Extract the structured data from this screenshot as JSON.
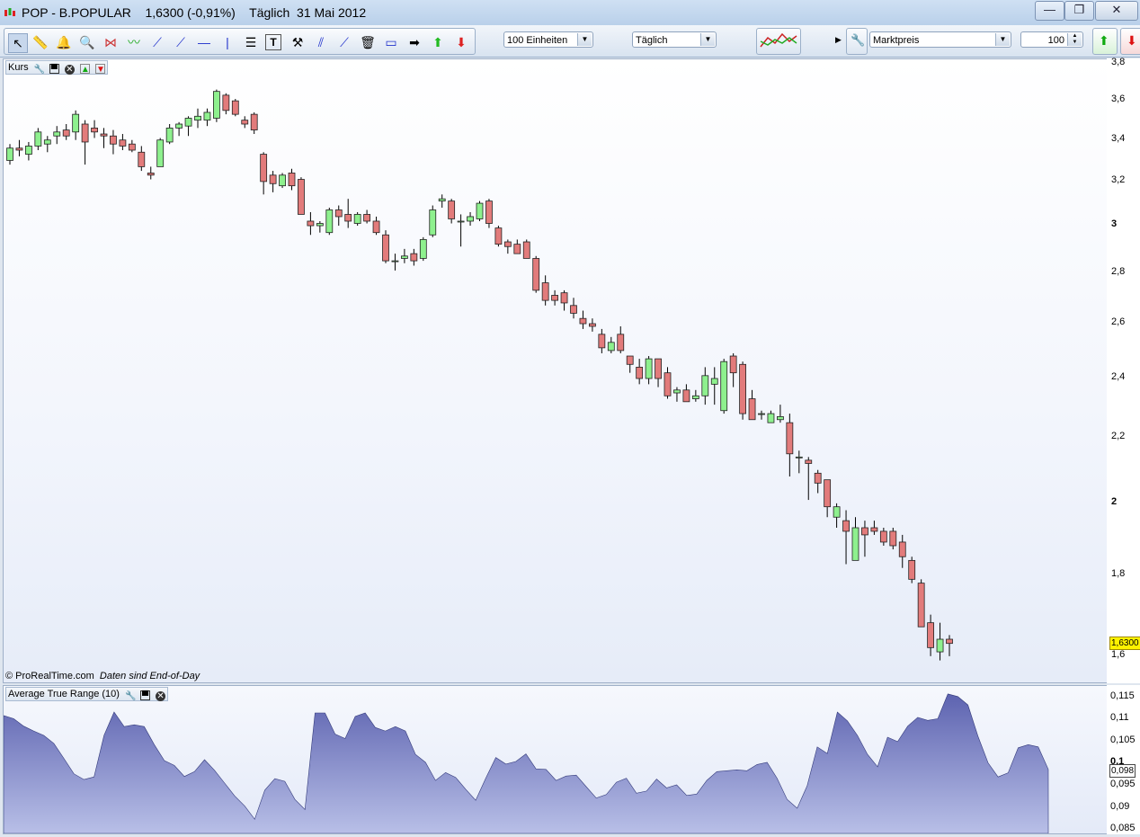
{
  "window": {
    "title": "POP - B.POPULAR    1,6300 (-0,91%)    Täglich  31 Mai 2012",
    "minimize_label": "—",
    "restore_label": "❐",
    "close_label": "✕"
  },
  "toolbar": {
    "units_select": "100 Einheiten",
    "period_select": "Täglich",
    "price_type_select": "Marktpreis",
    "quantity_value": "100"
  },
  "price_pane": {
    "header_label": "Kurs",
    "copyright": "© ProRealTime.com",
    "data_note": "Daten sind End-of-Day",
    "current_price_label": "1,6300",
    "y_ticks": [
      "3,8",
      "3,6",
      "3,4",
      "3,2",
      "3",
      "2,8",
      "2,6",
      "2,4",
      "2,2",
      "2",
      "1,8",
      "1,6"
    ]
  },
  "atr_pane": {
    "header_label": "Average True Range (10)",
    "current_value_label": "0,098",
    "y_ticks": [
      "0,115",
      "0,11",
      "0,105",
      "0,1",
      "0,095",
      "0,09",
      "0,085"
    ]
  },
  "colors": {
    "up_candle": "#8ef08e",
    "down_candle": "#e27b7b",
    "atr_fill_top": "#5d63b0",
    "atr_fill_bottom": "#b8bfe7",
    "price_label_bg": "#fff200"
  },
  "chart_data": [
    {
      "type": "candlestick",
      "title": "Kurs",
      "y_scale": "log",
      "ylim": [
        1.55,
        3.8
      ],
      "y_ticks": [
        3.8,
        3.6,
        3.4,
        3.2,
        3.0,
        2.8,
        2.6,
        2.4,
        2.2,
        2.0,
        1.8,
        1.6
      ],
      "last_value": 1.63,
      "candles": [
        [
          3.3,
          3.38,
          3.28,
          3.36
        ],
        [
          3.36,
          3.4,
          3.32,
          3.35
        ],
        [
          3.33,
          3.39,
          3.3,
          3.37
        ],
        [
          3.37,
          3.46,
          3.35,
          3.44
        ],
        [
          3.38,
          3.42,
          3.34,
          3.4
        ],
        [
          3.42,
          3.47,
          3.38,
          3.44
        ],
        [
          3.45,
          3.48,
          3.4,
          3.42
        ],
        [
          3.44,
          3.55,
          3.4,
          3.53
        ],
        [
          3.48,
          3.5,
          3.28,
          3.39
        ],
        [
          3.46,
          3.5,
          3.41,
          3.44
        ],
        [
          3.43,
          3.46,
          3.36,
          3.42
        ],
        [
          3.42,
          3.45,
          3.33,
          3.38
        ],
        [
          3.4,
          3.43,
          3.35,
          3.37
        ],
        [
          3.38,
          3.4,
          3.34,
          3.35
        ],
        [
          3.34,
          3.37,
          3.25,
          3.27
        ],
        [
          3.24,
          3.27,
          3.21,
          3.23
        ],
        [
          3.27,
          3.41,
          3.27,
          3.4
        ],
        [
          3.39,
          3.48,
          3.38,
          3.46
        ],
        [
          3.46,
          3.49,
          3.42,
          3.48
        ],
        [
          3.47,
          3.52,
          3.42,
          3.51
        ],
        [
          3.5,
          3.56,
          3.46,
          3.52
        ],
        [
          3.5,
          3.56,
          3.47,
          3.54
        ],
        [
          3.51,
          3.66,
          3.49,
          3.65
        ],
        [
          3.63,
          3.64,
          3.53,
          3.55
        ],
        [
          3.6,
          3.61,
          3.52,
          3.53
        ],
        [
          3.5,
          3.52,
          3.46,
          3.48
        ],
        [
          3.53,
          3.54,
          3.43,
          3.45
        ],
        [
          3.33,
          3.34,
          3.14,
          3.2
        ],
        [
          3.23,
          3.25,
          3.15,
          3.19
        ],
        [
          3.18,
          3.24,
          3.17,
          3.23
        ],
        [
          3.24,
          3.26,
          3.16,
          3.18
        ],
        [
          3.21,
          3.22,
          3.06,
          3.05
        ],
        [
          3.02,
          3.06,
          2.96,
          3.0
        ],
        [
          3.0,
          3.02,
          2.97,
          3.01
        ],
        [
          2.97,
          3.08,
          2.96,
          3.07
        ],
        [
          3.07,
          3.09,
          3.0,
          3.04
        ],
        [
          3.05,
          3.12,
          2.99,
          3.02
        ],
        [
          3.01,
          3.06,
          3.0,
          3.05
        ],
        [
          3.05,
          3.07,
          3.01,
          3.02
        ],
        [
          3.02,
          3.04,
          2.96,
          2.97
        ],
        [
          2.96,
          2.98,
          2.84,
          2.85
        ],
        [
          2.85,
          2.88,
          2.81,
          2.85
        ],
        [
          2.86,
          2.9,
          2.84,
          2.87
        ],
        [
          2.88,
          2.9,
          2.83,
          2.85
        ],
        [
          2.86,
          2.95,
          2.85,
          2.94
        ],
        [
          2.96,
          3.09,
          2.95,
          3.07
        ],
        [
          3.11,
          3.14,
          3.08,
          3.12
        ],
        [
          3.11,
          3.12,
          3.01,
          3.03
        ],
        [
          3.02,
          3.05,
          2.91,
          3.02
        ],
        [
          3.02,
          3.06,
          3.0,
          3.04
        ],
        [
          3.03,
          3.11,
          3.02,
          3.1
        ],
        [
          3.11,
          3.12,
          2.99,
          3.01
        ],
        [
          2.99,
          3.0,
          2.91,
          2.92
        ],
        [
          2.93,
          2.94,
          2.88,
          2.91
        ],
        [
          2.92,
          2.94,
          2.88,
          2.88
        ],
        [
          2.93,
          2.94,
          2.86,
          2.86
        ],
        [
          2.86,
          2.87,
          2.72,
          2.73
        ],
        [
          2.76,
          2.79,
          2.67,
          2.69
        ],
        [
          2.71,
          2.73,
          2.67,
          2.69
        ],
        [
          2.72,
          2.73,
          2.65,
          2.68
        ],
        [
          2.67,
          2.7,
          2.62,
          2.64
        ],
        [
          2.62,
          2.65,
          2.58,
          2.6
        ],
        [
          2.6,
          2.62,
          2.57,
          2.59
        ],
        [
          2.56,
          2.58,
          2.49,
          2.51
        ],
        [
          2.5,
          2.55,
          2.49,
          2.53
        ],
        [
          2.56,
          2.59,
          2.49,
          2.5
        ],
        [
          2.48,
          2.48,
          2.42,
          2.45
        ],
        [
          2.44,
          2.47,
          2.38,
          2.4
        ],
        [
          2.4,
          2.48,
          2.38,
          2.47
        ],
        [
          2.47,
          2.47,
          2.37,
          2.4
        ],
        [
          2.42,
          2.44,
          2.33,
          2.34
        ],
        [
          2.35,
          2.37,
          2.32,
          2.36
        ],
        [
          2.36,
          2.38,
          2.32,
          2.32
        ],
        [
          2.33,
          2.36,
          2.32,
          2.34
        ],
        [
          2.34,
          2.44,
          2.31,
          2.41
        ],
        [
          2.38,
          2.44,
          2.31,
          2.4
        ],
        [
          2.29,
          2.47,
          2.28,
          2.46
        ],
        [
          2.48,
          2.49,
          2.37,
          2.42
        ],
        [
          2.45,
          2.46,
          2.26,
          2.28
        ],
        [
          2.33,
          2.36,
          2.26,
          2.26
        ],
        [
          2.28,
          2.29,
          2.26,
          2.28
        ],
        [
          2.25,
          2.29,
          2.25,
          2.28
        ],
        [
          2.26,
          2.31,
          2.25,
          2.27
        ],
        [
          2.25,
          2.28,
          2.08,
          2.15
        ],
        [
          2.14,
          2.16,
          2.09,
          2.14
        ],
        [
          2.13,
          2.14,
          2.01,
          2.12
        ],
        [
          2.09,
          2.1,
          2.03,
          2.06
        ],
        [
          2.07,
          2.07,
          1.96,
          1.99
        ],
        [
          1.96,
          2.0,
          1.93,
          1.99
        ],
        [
          1.95,
          1.98,
          1.83,
          1.92
        ],
        [
          1.84,
          1.96,
          1.84,
          1.93
        ],
        [
          1.93,
          1.95,
          1.85,
          1.91
        ],
        [
          1.93,
          1.95,
          1.91,
          1.92
        ],
        [
          1.92,
          1.93,
          1.88,
          1.89
        ],
        [
          1.92,
          1.93,
          1.87,
          1.88
        ],
        [
          1.89,
          1.91,
          1.82,
          1.85
        ],
        [
          1.84,
          1.85,
          1.78,
          1.79
        ],
        [
          1.78,
          1.79,
          1.67,
          1.67
        ],
        [
          1.68,
          1.7,
          1.6,
          1.62
        ],
        [
          1.61,
          1.68,
          1.59,
          1.64
        ],
        [
          1.64,
          1.65,
          1.6,
          1.63
        ]
      ]
    },
    {
      "type": "area",
      "title": "Average True Range (10)",
      "ylim": [
        0.084,
        0.117
      ],
      "y_ticks": [
        0.115,
        0.11,
        0.105,
        0.1,
        0.095,
        0.09,
        0.085
      ],
      "last_value": 0.098,
      "values": [
        0.1107,
        0.11,
        0.1083,
        0.1072,
        0.1062,
        0.1044,
        0.101,
        0.0975,
        0.0962,
        0.0968,
        0.1062,
        0.1115,
        0.1082,
        0.1086,
        0.1082,
        0.1041,
        0.1005,
        0.0994,
        0.0969,
        0.098,
        0.1007,
        0.0983,
        0.0954,
        0.0925,
        0.0902,
        0.0872,
        0.0938,
        0.0964,
        0.0958,
        0.0917,
        0.0894,
        0.1113,
        0.1113,
        0.1065,
        0.1055,
        0.1105,
        0.1113,
        0.108,
        0.1072,
        0.1082,
        0.1072,
        0.1019,
        0.1001,
        0.096,
        0.0978,
        0.0967,
        0.094,
        0.0915,
        0.0965,
        0.1012,
        0.0997,
        0.1003,
        0.102,
        0.0986,
        0.0985,
        0.096,
        0.097,
        0.0972,
        0.0946,
        0.092,
        0.0928,
        0.0956,
        0.0965,
        0.0931,
        0.0936,
        0.0963,
        0.0943,
        0.095,
        0.0926,
        0.0929,
        0.096,
        0.098,
        0.0982,
        0.0984,
        0.0982,
        0.0996,
        0.1001,
        0.0965,
        0.0917,
        0.0897,
        0.0948,
        0.1036,
        0.1021,
        0.1115,
        0.1095,
        0.1062,
        0.1019,
        0.0991,
        0.1058,
        0.1048,
        0.1083,
        0.1103,
        0.1096,
        0.11,
        0.1156,
        0.115,
        0.1131,
        0.106,
        0.1,
        0.0968,
        0.0977,
        0.1034,
        0.1041,
        0.1036,
        0.0985
      ]
    }
  ]
}
